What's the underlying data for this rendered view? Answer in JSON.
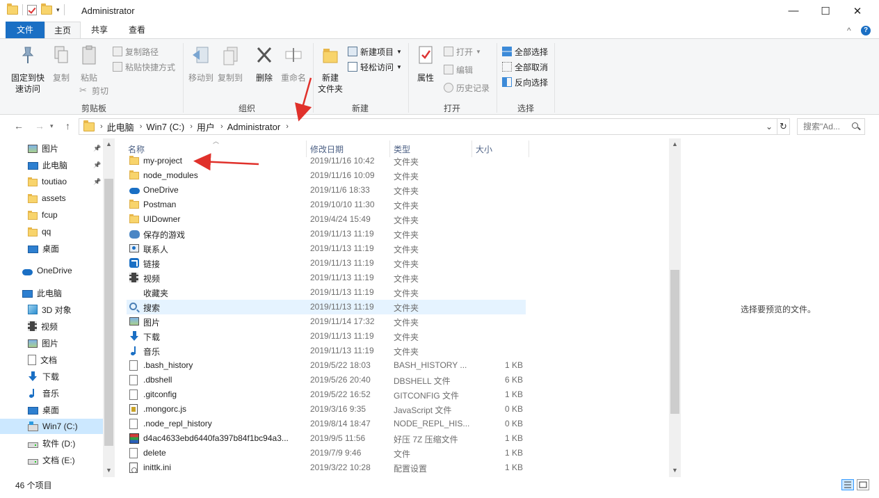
{
  "window": {
    "title": "Administrator",
    "minimize": "—",
    "maximize": "☐",
    "close": "✕"
  },
  "ribbon_tabs": {
    "file": "文件",
    "home": "主页",
    "share": "共享",
    "view": "查看",
    "collapse": "^",
    "help": "?"
  },
  "ribbon": {
    "clipboard": {
      "label": "剪贴板",
      "pin": "固定到快\n速访问",
      "copy": "复制",
      "paste": "粘贴",
      "copy_path": "复制路径",
      "paste_shortcut": "粘贴快捷方式",
      "cut": "剪切"
    },
    "organize": {
      "label": "组织",
      "move_to": "移动到",
      "copy_to": "复制到",
      "delete": "删除",
      "rename": "重命名"
    },
    "new": {
      "label": "新建",
      "new_folder": "新建\n文件夹",
      "new_item": "新建项目",
      "easy_access": "轻松访问"
    },
    "open": {
      "label": "打开",
      "properties": "属性",
      "open": "打开",
      "edit": "编辑",
      "history": "历史记录"
    },
    "select": {
      "label": "选择",
      "select_all": "全部选择",
      "select_none": "全部取消",
      "invert": "反向选择"
    }
  },
  "address": {
    "back": "←",
    "forward": "→",
    "up": "↑",
    "crumbs": [
      "此电脑",
      "Win7 (C:)",
      "用户",
      "Administrator"
    ],
    "separator": "›",
    "dropdown": "⌄",
    "refresh": "↻",
    "search_placeholder": "搜索\"Ad..."
  },
  "nav_pane": {
    "items": [
      {
        "label": "图片",
        "icon": "pictures-icon",
        "pinned": true
      },
      {
        "label": "此电脑",
        "icon": "pc-icon",
        "pinned": true
      },
      {
        "label": "toutiao",
        "icon": "folder-icon",
        "pinned": true
      },
      {
        "label": "assets",
        "icon": "folder-icon"
      },
      {
        "label": "fcup",
        "icon": "folder-icon"
      },
      {
        "label": "qq",
        "icon": "folder-icon"
      },
      {
        "label": "桌面",
        "icon": "desktop-icon"
      },
      {
        "label": "OneDrive",
        "icon": "onedrive-icon"
      },
      {
        "label": "此电脑",
        "icon": "pc-icon"
      },
      {
        "label": "3D 对象",
        "icon": "3d-objects-icon"
      },
      {
        "label": "视频",
        "icon": "videos-icon"
      },
      {
        "label": "图片",
        "icon": "pictures-icon"
      },
      {
        "label": "文档",
        "icon": "documents-icon"
      },
      {
        "label": "下载",
        "icon": "downloads-icon"
      },
      {
        "label": "音乐",
        "icon": "music-icon"
      },
      {
        "label": "桌面",
        "icon": "desktop-icon"
      },
      {
        "label": "Win7 (C:)",
        "icon": "system-drive-icon",
        "selected": true
      },
      {
        "label": "软件 (D:)",
        "icon": "drive-icon"
      },
      {
        "label": "文档 (E:)",
        "icon": "drive-icon"
      }
    ]
  },
  "file_list": {
    "columns": {
      "name": "名称",
      "date": "修改日期",
      "type": "类型",
      "size": "大小"
    },
    "rows": [
      {
        "name": "my-project",
        "date": "2019/11/16 10:42",
        "type": "文件夹",
        "size": "",
        "icon": "folder-icon"
      },
      {
        "name": "node_modules",
        "date": "2019/11/16 10:09",
        "type": "文件夹",
        "size": "",
        "icon": "folder-icon"
      },
      {
        "name": "OneDrive",
        "date": "2019/11/6 18:33",
        "type": "文件夹",
        "size": "",
        "icon": "onedrive-icon"
      },
      {
        "name": "Postman",
        "date": "2019/10/10 11:30",
        "type": "文件夹",
        "size": "",
        "icon": "folder-icon"
      },
      {
        "name": "UIDowner",
        "date": "2019/4/24 15:49",
        "type": "文件夹",
        "size": "",
        "icon": "folder-icon"
      },
      {
        "name": "保存的游戏",
        "date": "2019/11/13 11:19",
        "type": "文件夹",
        "size": "",
        "icon": "saved-games-icon"
      },
      {
        "name": "联系人",
        "date": "2019/11/13 11:19",
        "type": "文件夹",
        "size": "",
        "icon": "contacts-icon"
      },
      {
        "name": "链接",
        "date": "2019/11/13 11:19",
        "type": "文件夹",
        "size": "",
        "icon": "links-icon"
      },
      {
        "name": "视频",
        "date": "2019/11/13 11:19",
        "type": "文件夹",
        "size": "",
        "icon": "videos-icon"
      },
      {
        "name": "收藏夹",
        "date": "2019/11/13 11:19",
        "type": "文件夹",
        "size": "",
        "icon": "favorites-icon"
      },
      {
        "name": "搜索",
        "date": "2019/11/13 11:19",
        "type": "文件夹",
        "size": "",
        "icon": "searches-icon",
        "hover": true
      },
      {
        "name": "图片",
        "date": "2019/11/14 17:32",
        "type": "文件夹",
        "size": "",
        "icon": "pictures-icon"
      },
      {
        "name": "下载",
        "date": "2019/11/13 11:19",
        "type": "文件夹",
        "size": "",
        "icon": "downloads-icon"
      },
      {
        "name": "音乐",
        "date": "2019/11/13 11:19",
        "type": "文件夹",
        "size": "",
        "icon": "music-icon"
      },
      {
        "name": ".bash_history",
        "date": "2019/5/22 18:03",
        "type": "BASH_HISTORY ...",
        "size": "1 KB",
        "icon": "file-icon"
      },
      {
        "name": ".dbshell",
        "date": "2019/5/26 20:40",
        "type": "DBSHELL 文件",
        "size": "6 KB",
        "icon": "file-icon"
      },
      {
        "name": ".gitconfig",
        "date": "2019/5/22 16:52",
        "type": "GITCONFIG 文件",
        "size": "1 KB",
        "icon": "file-icon"
      },
      {
        "name": ".mongorc.js",
        "date": "2019/3/16 9:35",
        "type": "JavaScript 文件",
        "size": "0 KB",
        "icon": "js-file-icon"
      },
      {
        "name": ".node_repl_history",
        "date": "2019/8/14 18:47",
        "type": "NODE_REPL_HIS...",
        "size": "0 KB",
        "icon": "file-icon"
      },
      {
        "name": "d4ac4633ebd6440fa397b84f1bc94a3...",
        "date": "2019/9/5 11:56",
        "type": "好压 7Z 压缩文件",
        "size": "1 KB",
        "icon": "archive-icon"
      },
      {
        "name": "delete",
        "date": "2019/7/9 9:46",
        "type": "文件",
        "size": "1 KB",
        "icon": "file-icon"
      },
      {
        "name": "inittk.ini",
        "date": "2019/3/22 10:28",
        "type": "配置设置",
        "size": "1 KB",
        "icon": "ini-file-icon"
      }
    ]
  },
  "preview": {
    "message": "选择要预览的文件。"
  },
  "status": {
    "item_count": "46 个项目"
  },
  "colors": {
    "accent": "#1a6fc4",
    "selection": "#cce8ff",
    "hover": "#e5f3ff",
    "annotation_arrow": "#e0312b"
  }
}
